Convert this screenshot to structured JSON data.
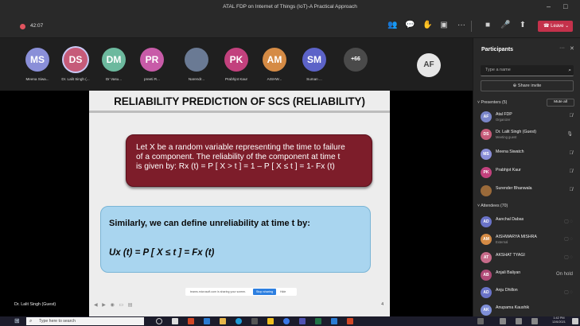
{
  "window": {
    "title": "ATAL FDP on Internet of Things (IoT)-A Practical Approach"
  },
  "toolbar": {
    "timer": "42:07",
    "leave_label": "Leave"
  },
  "gallery": {
    "tiles": [
      {
        "initials": "MS",
        "label": "Meena Siwa...",
        "color": "#8a8fd8"
      },
      {
        "initials": "DS",
        "label": "Dr. Lalit Singh (...",
        "color": "#c65b79"
      },
      {
        "initials": "DM",
        "label": "Dr Vasu...",
        "color": "#6cb99e"
      },
      {
        "initials": "PR",
        "label": "preeti R...",
        "color": "#c85ba8"
      },
      {
        "initials": "",
        "label": "Narendr...",
        "color": "#6a7a94"
      },
      {
        "initials": "PK",
        "label": "Prabhjot Kaur",
        "color": "#c2417d"
      },
      {
        "initials": "AM",
        "label": "AISHW...",
        "color": "#d58b45"
      },
      {
        "initials": "SM",
        "label": "Suman ...",
        "color": "#5c63c8"
      },
      {
        "initials": "+66",
        "label": "",
        "color": "#4a4a4a"
      }
    ],
    "featured_initials": "AF"
  },
  "slide": {
    "title": "RELIABILITY PREDICTION OF SCS (RELIABILITY)",
    "def_line1": "Let X be a random variable representing the time to failure",
    "def_line2": "of a component. The reliability of the component at time t",
    "def_line3": "is given by: Rx (t) = P [ X > t ] = 1 – P [ X ≤ t ] = 1- Fx (t)",
    "unrel_line": "Similarly, we can define unreliability at time t by:",
    "unrel_formula": "Ux (t) = P [ X ≤ t ] = Fx (t)",
    "page_number": "4"
  },
  "share_bar": {
    "message": "teams.microsoft.com is sharing your screen.",
    "stop_label": "Stop sharing",
    "hide_label": "Hide"
  },
  "stage": {
    "presenter_label": "Dr. Lalit Singh (Guest)"
  },
  "panel": {
    "title": "Participants",
    "search_placeholder": "Type a name",
    "share_invite": "Share invite",
    "presenters_header": "Presenters (5)",
    "mute_all": "Mute all",
    "attendees_header": "Attendees (70)",
    "presenters": [
      {
        "initials": "AF",
        "name": "Atal FDP",
        "sub": "Organizer",
        "color": "#7a86c9",
        "state": "mic-off"
      },
      {
        "initials": "DS",
        "name": "Dr. Lalit Singh (Guest)",
        "sub": "Meeting guest",
        "color": "#c65b79",
        "state": "mic-on"
      },
      {
        "initials": "MS",
        "name": "Meena Siwatch",
        "sub": "",
        "color": "#8a8fd8",
        "state": "mic-off"
      },
      {
        "initials": "PK",
        "name": "Prabhjot Kaur",
        "sub": "",
        "color": "#c2417d",
        "state": "mic-off"
      },
      {
        "initials": "",
        "name": "Surender Bhanwala",
        "sub": "",
        "color": "#9a6a3a",
        "state": "mic-off"
      }
    ],
    "attendees": [
      {
        "initials": "AD",
        "name": "Aanchal Dabas",
        "sub": "",
        "color": "#6a73c8",
        "state": ""
      },
      {
        "initials": "AM",
        "name": "AISHWARYA MISHRA",
        "sub": "External",
        "color": "#d58b45",
        "state": ""
      },
      {
        "initials": "AT",
        "name": "AKSHAT TYAGI",
        "sub": "",
        "color": "#c86b8a",
        "state": ""
      },
      {
        "initials": "AB",
        "name": "Anjali Baliyan",
        "sub": "",
        "color": "#b04a77",
        "state": "On hold"
      },
      {
        "initials": "AD",
        "name": "Anju Dhillon",
        "sub": "",
        "color": "#6a73c8",
        "state": ""
      },
      {
        "initials": "AK",
        "name": "Anupama Kaushik",
        "sub": "",
        "color": "#7f8fd8",
        "state": ""
      }
    ]
  },
  "taskbar": {
    "search_placeholder": "Type here to search",
    "time": "1:42 PM",
    "date": "12/6/2021"
  }
}
